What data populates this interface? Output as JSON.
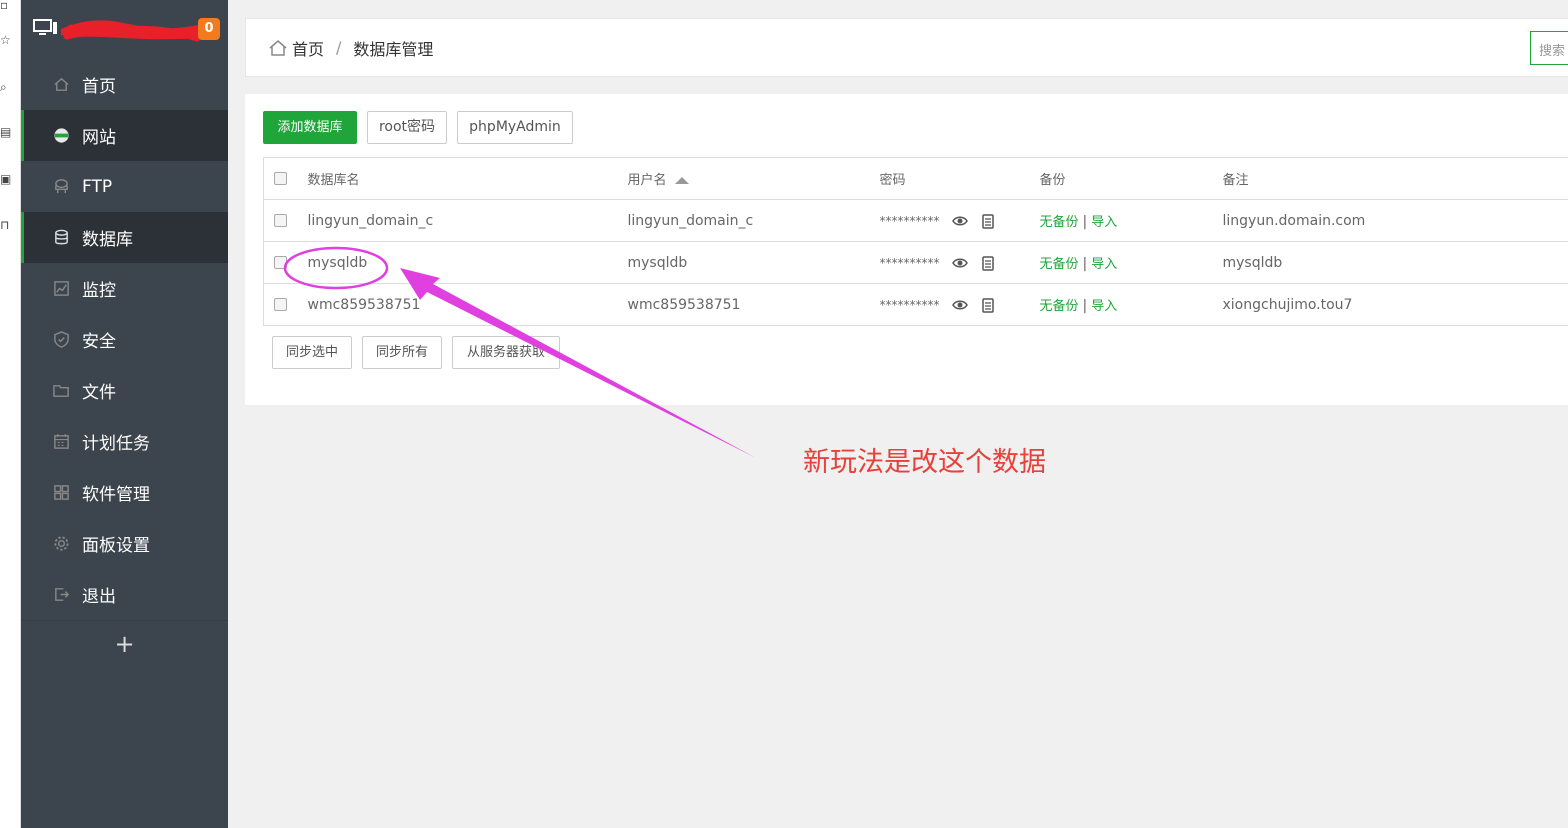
{
  "badge_count": "0",
  "sidebar": {
    "items": [
      {
        "label": "首页",
        "icon": "home-icon"
      },
      {
        "label": "网站",
        "icon": "globe-icon"
      },
      {
        "label": "FTP",
        "icon": "ftp-server-icon"
      },
      {
        "label": "数据库",
        "icon": "database-icon"
      },
      {
        "label": "监控",
        "icon": "monitor-chart-icon"
      },
      {
        "label": "安全",
        "icon": "shield-icon"
      },
      {
        "label": "文件",
        "icon": "folder-icon"
      },
      {
        "label": "计划任务",
        "icon": "calendar-icon"
      },
      {
        "label": "软件管理",
        "icon": "apps-grid-icon"
      },
      {
        "label": "面板设置",
        "icon": "gear-icon"
      },
      {
        "label": "退出",
        "icon": "logout-icon"
      }
    ],
    "add_label": "+"
  },
  "breadcrumb": {
    "home": "首页",
    "separator": "/",
    "current": "数据库管理"
  },
  "search": {
    "placeholder": "搜索"
  },
  "toolbar": {
    "add_db": "添加数据库",
    "root_pw": "root密码",
    "phpmyadmin": "phpMyAdmin"
  },
  "table": {
    "headers": {
      "name": "数据库名",
      "user": "用户名",
      "password": "密码",
      "backup": "备份",
      "remark": "备注"
    },
    "rows": [
      {
        "name": "lingyun_domain_c",
        "user": "lingyun_domain_c",
        "password": "**********",
        "backup": "无备份",
        "import": "导入",
        "remark": "lingyun.domain.com"
      },
      {
        "name": "mysqldb",
        "user": "mysqldb",
        "password": "**********",
        "backup": "无备份",
        "import": "导入",
        "remark": "mysqldb"
      },
      {
        "name": "wmc859538751",
        "user": "wmc859538751",
        "password": "**********",
        "backup": "无备份",
        "import": "导入",
        "remark": "xiongchujimo.tou7"
      }
    ]
  },
  "bottom_buttons": {
    "sync_selected": "同步选中",
    "sync_all": "同步所有",
    "fetch_from_server": "从服务器获取"
  },
  "annotation": {
    "text": "新玩法是改这个数据",
    "color": "#e8403a",
    "arrow_color": "#e040e0"
  },
  "colors": {
    "accent_green": "#20a53a",
    "sidebar_bg": "#3c444d",
    "sidebar_active": "#2c3138",
    "badge_orange": "#f37b1d"
  }
}
